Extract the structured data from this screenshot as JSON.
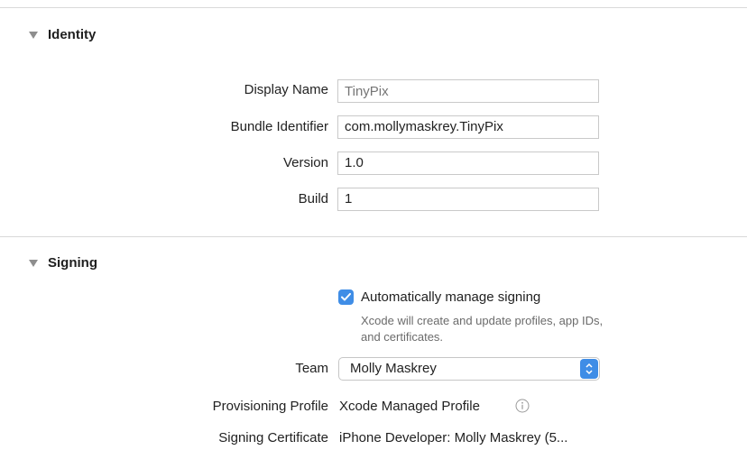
{
  "identity": {
    "title": "Identity",
    "display_name": {
      "label": "Display Name",
      "placeholder": "TinyPix"
    },
    "bundle_identifier": {
      "label": "Bundle Identifier",
      "value": "com.mollymaskrey.TinyPix"
    },
    "version": {
      "label": "Version",
      "value": "1.0"
    },
    "build": {
      "label": "Build",
      "value": "1"
    }
  },
  "signing": {
    "title": "Signing",
    "auto_manage": {
      "checked": true,
      "label": "Automatically manage signing",
      "description": "Xcode will create and update profiles, app IDs, and certificates."
    },
    "team": {
      "label": "Team",
      "value": "Molly Maskrey"
    },
    "provisioning_profile": {
      "label": "Provisioning Profile",
      "value": "Xcode Managed Profile"
    },
    "signing_certificate": {
      "label": "Signing Certificate",
      "value": "iPhone Developer: Molly Maskrey (5..."
    }
  },
  "colors": {
    "accent": "#3f8de6",
    "divider": "#d9d9d9"
  },
  "icons": {
    "disclosure": "disclosure-triangle-icon",
    "info": "info-icon",
    "check": "checkmark-icon",
    "stepper": "popup-stepper-icon"
  }
}
